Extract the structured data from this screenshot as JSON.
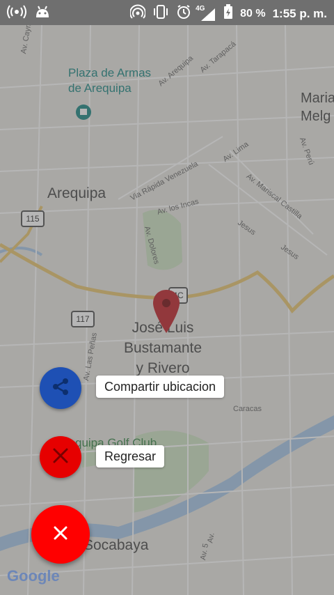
{
  "status_bar": {
    "left_icons": [
      "broadcast-icon",
      "android-icon"
    ],
    "right_icons": [
      "hotspot-icon",
      "vibrate-icon",
      "alarm-icon",
      "signal-4g-icon",
      "battery-charging-icon"
    ],
    "network": "4G",
    "battery": "80 %",
    "time": "1:55 p. m."
  },
  "map": {
    "labels": {
      "plaza_line1": "Plaza de Armas",
      "plaza_line2": "de Arequipa",
      "arequipa": "Arequipa",
      "jose_line1": "José Luis",
      "jose_line2": "Bustamante",
      "jose_line3": "y Rivero",
      "socabaya": "Socabaya",
      "maria_line1": "Maria",
      "maria_line2": "Melg",
      "golf": "quipa Golf Club"
    },
    "streets": {
      "cayma": "Av. Cayma",
      "av_arequipa": "Av. Arequipa",
      "tarapaca": "Av. Tarapacá",
      "via_rapida": "Via Rápida Venezuela",
      "lima": "Av. Lima",
      "peru": "Av. Perú",
      "mariscal": "Av. Mariscal Castilla",
      "los_incas": "Av. los Incas",
      "dolores": "Av. Dolores",
      "jesus1": "Jesus",
      "jesus2": "Jesus",
      "las_penas": "Av. Las Peñas",
      "caracas": "Caracas",
      "av5": "Av. 5",
      "av_small": "Av."
    },
    "shields": {
      "r115": "115",
      "r117": "117",
      "r4c": "4C"
    }
  },
  "actions": {
    "share_label": "Compartir ubicacion",
    "back_label": "Regresar"
  },
  "branding": {
    "google": "Google"
  },
  "colors": {
    "share": "#1e50b4",
    "back": "#e60000",
    "main": "#ff0000",
    "pin": "#c1272d"
  }
}
